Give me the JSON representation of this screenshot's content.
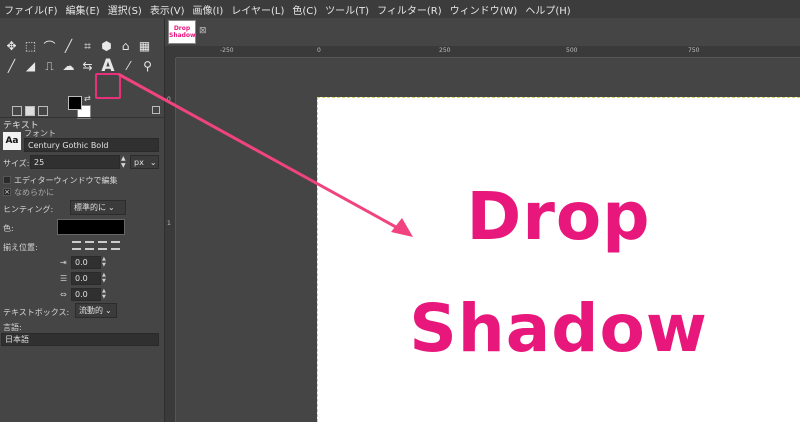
{
  "menu": [
    "ファイル(F)",
    "編集(E)",
    "選択(S)",
    "表示(V)",
    "画像(I)",
    "レイヤー(L)",
    "色(C)",
    "ツール(T)",
    "フィルター(R)",
    "ウィンドウ(W)",
    "ヘルプ(H)"
  ],
  "tools_row1": [
    "✥",
    "⬚",
    "⌒",
    "╱",
    "⌗",
    "⬢",
    "⌂",
    "▦"
  ],
  "tools_row2": [
    "╱",
    "◢",
    "⎍",
    "☁",
    "⇆",
    "A",
    "⁄",
    "⚲"
  ],
  "panel": {
    "title": "テキスト",
    "font_label": "フォント",
    "font_icon": "Aa",
    "font_value": "Century Gothic Bold",
    "size_label": "サイズ:",
    "size_value": "25",
    "size_unit": "px",
    "editor_label": "エディターウィンドウで編集",
    "smooth_label": "なめらかに",
    "hinting_label": "ヒンティング:",
    "hinting_value": "標準的に",
    "color_label": "色:",
    "color_value": "#000000",
    "justify_label": "揃え位置:",
    "indent_value": "0.0",
    "line_spacing_value": "0.0",
    "letter_spacing_value": "0.0",
    "box_label": "テキストボックス:",
    "box_value": "流動的",
    "language_label": "言語:",
    "language_value": "日本語"
  },
  "image_tab": {
    "line1": "Drop",
    "line2": "Shadow",
    "close": "⊠"
  },
  "ruler_top": [
    "-250",
    "0",
    "250",
    "500",
    "750"
  ],
  "ruler_left": [
    "0",
    "1"
  ],
  "canvas_text": {
    "line1": "Drop",
    "line2": "Shadow"
  },
  "accent_color": "#e8177c",
  "arrow_color": "#f0437f"
}
